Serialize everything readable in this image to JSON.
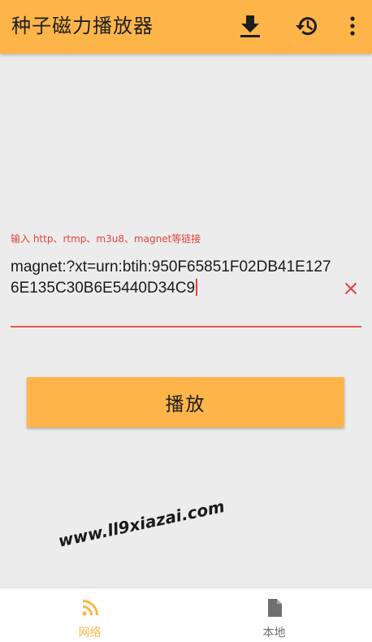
{
  "app_bar": {
    "title": "种子磁力播放器",
    "actions": [
      {
        "name": "download",
        "icon": "download-icon"
      },
      {
        "name": "history",
        "icon": "history-icon"
      },
      {
        "name": "more",
        "icon": "more-vert-icon"
      }
    ],
    "background": "#fdb549"
  },
  "url_field": {
    "label": "输入 http、rtmp、m3u8、magnet等链接",
    "value": "magnet:?xt=urn:btih:950F65851F02DB41E1276E135C30B6E5440D34C9",
    "clear_icon": "close-icon",
    "accent": "#e0433c"
  },
  "play_button": {
    "label": "播放",
    "background": "#fdb549"
  },
  "watermark": {
    "text": "www.ll9xiazai.com"
  },
  "bottom_nav": {
    "items": [
      {
        "label": "网络",
        "icon": "rss-feed-icon",
        "active": true
      },
      {
        "label": "本地",
        "icon": "file-icon",
        "active": false
      }
    ],
    "active_color": "#fdb549",
    "inactive_color": "#6f6f6f"
  }
}
